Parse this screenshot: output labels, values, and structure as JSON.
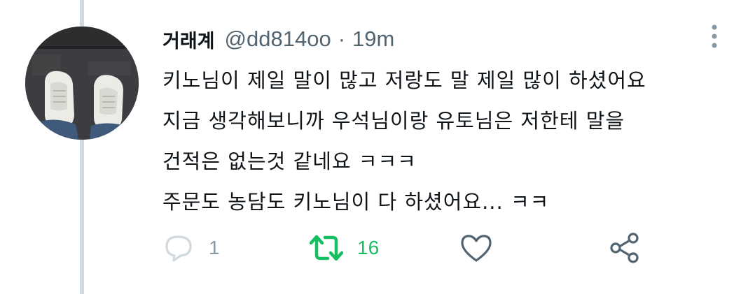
{
  "tweet": {
    "display_name": "거래계",
    "handle": "@dd814oo",
    "separator": "·",
    "time": "19m",
    "lines": [
      "키노님이 제일 말이 많고 저랑도 말 제일 많이 하셨어요",
      "지금 생각해보니까 우석님이랑 유토님은 저한테 말을",
      "건적은 없는것 같네요 ㅋㅋㅋ",
      "주문도 농담도 키노님이 다 하셨어요... ㅋㅋ"
    ]
  },
  "actions": {
    "reply_count": "1",
    "retweet_count": "16"
  },
  "icons": {
    "more": "more-vertical-icon",
    "reply": "reply-icon",
    "retweet": "retweet-icon",
    "like": "heart-icon",
    "share": "share-icon"
  },
  "colors": {
    "muted": "#536471",
    "icon_gray": "#8899a6",
    "retweet_active": "#17bf63",
    "thread_line": "#cfd9de"
  }
}
